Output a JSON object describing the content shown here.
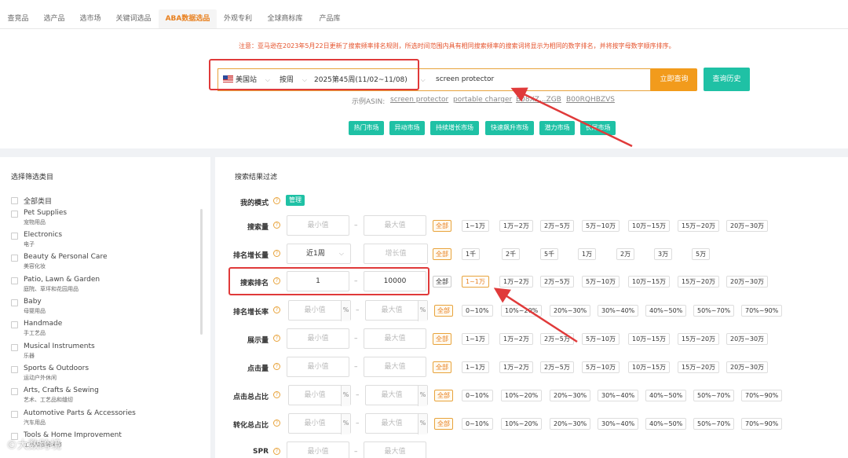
{
  "tabs": [
    "查竞品",
    "选产品",
    "选市场",
    "关键词选品",
    "ABA数据选品",
    "外观专利",
    "全球商标库",
    "产品库"
  ],
  "notice": "注意：亚马逊在2023年5月22日更新了搜索频率排名规则，所选时间范围内具有相同搜索频率的搜索词将显示为相同的数字排名，并将按字母数字顺序排序。",
  "search": {
    "site": "美国站",
    "mode": "按周",
    "period": "2025第45周(11/02~11/08)",
    "keyword": "screen protector",
    "query_button": "立即查询",
    "history_button": "查询历史"
  },
  "examples": {
    "label": "示例ASIN:",
    "items": [
      "screen protector",
      "portable charger",
      "B08XZ...ZGB",
      "B00RQHBZVS"
    ]
  },
  "markets": [
    "热门市场",
    "异动市场",
    "持续增长市场",
    "快速飙升市场",
    "潜力市场",
    "长尾市场"
  ],
  "left_panel": {
    "title": "选择筛选类目",
    "all_label": "全部类目",
    "categories": [
      {
        "en": "Pet Supplies",
        "zh": "宠物用品"
      },
      {
        "en": "Electronics",
        "zh": "电子"
      },
      {
        "en": "Beauty & Personal Care",
        "zh": "美容化妆"
      },
      {
        "en": "Patio, Lawn & Garden",
        "zh": "庭院、草坪和花园用品"
      },
      {
        "en": "Baby",
        "zh": "母婴用品"
      },
      {
        "en": "Handmade",
        "zh": "手工艺品"
      },
      {
        "en": "Musical Instruments",
        "zh": "乐器"
      },
      {
        "en": "Sports & Outdoors",
        "zh": "运动户外休闲"
      },
      {
        "en": "Arts, Crafts & Sewing",
        "zh": "艺术、工艺品和缝纫"
      },
      {
        "en": "Automotive Parts & Accessories",
        "zh": "汽车用品"
      },
      {
        "en": "Tools & Home Improvement",
        "zh": "工具和家居装修"
      }
    ]
  },
  "filters": {
    "title": "搜索结果过滤",
    "my_mode_label": "我的模式",
    "manage": "管理",
    "min_ph": "最小值",
    "max_ph": "最大值",
    "growth_ph": "增长值",
    "all": "全部",
    "pct": "%",
    "dash": "–",
    "rows": [
      {
        "label": "搜索量",
        "chips": [
          "1~1万",
          "1万~2万",
          "2万~5万",
          "5万~10万",
          "10万~15万",
          "15万~20万",
          "20万~30万"
        ]
      },
      {
        "label": "排名增长量",
        "select": "近1周",
        "chips": [
          "1千",
          "2千",
          "5千",
          "1万",
          "2万",
          "3万",
          "5万"
        ]
      },
      {
        "label": "搜索排名",
        "min": "1",
        "max": "10000",
        "chips": [
          "1~1万",
          "1万~2万",
          "2万~5万",
          "5万~10万",
          "10万~15万",
          "15万~20万",
          "20万~30万"
        ]
      },
      {
        "label": "排名增长率",
        "chips": [
          "0~10%",
          "10%~20%",
          "20%~30%",
          "30%~40%",
          "40%~50%",
          "50%~70%",
          "70%~90%"
        ]
      },
      {
        "label": "展示量",
        "chips": [
          "1~1万",
          "1万~2万",
          "2万~5万",
          "5万~10万",
          "10万~15万",
          "15万~20万",
          "20万~30万"
        ]
      },
      {
        "label": "点击量",
        "chips": [
          "1~1万",
          "1万~2万",
          "2万~5万",
          "5万~10万",
          "10万~15万",
          "15万~20万",
          "20万~30万"
        ]
      },
      {
        "label": "点击总占比",
        "chips": [
          "0~10%",
          "10%~20%",
          "20%~30%",
          "30%~40%",
          "40%~50%",
          "50%~70%",
          "70%~90%"
        ]
      },
      {
        "label": "转化总占比",
        "chips": [
          "0~10%",
          "10%~20%",
          "20%~30%",
          "30%~40%",
          "40%~50%",
          "50%~70%",
          "70%~90%"
        ]
      },
      {
        "label": "SPR"
      }
    ]
  },
  "watermark": "©大数跨境",
  "colors": {
    "accent": "#e8801f",
    "teal": "#1fc1a5",
    "annotation_red": "#e03a3a"
  }
}
